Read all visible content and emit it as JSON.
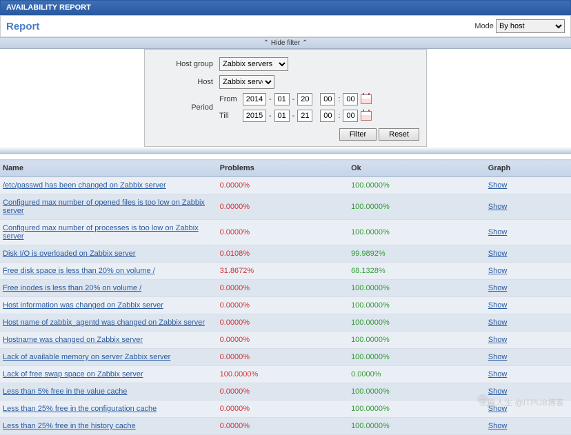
{
  "breadcrumb": "AVAILABILITY REPORT",
  "report_bar": {
    "title": "Report",
    "mode_label": "Mode",
    "mode_selected": "By host"
  },
  "filter_toggle": "Hide filter",
  "filter": {
    "host_group_label": "Host group",
    "host_group_value": "Zabbix servers",
    "host_label": "Host",
    "host_value": "Zabbix server",
    "period_label": "Period",
    "from_label": "From",
    "till_label": "Till",
    "from": {
      "y": "2014",
      "m": "01",
      "d": "20",
      "h": "00",
      "mi": "00"
    },
    "till": {
      "y": "2015",
      "m": "01",
      "d": "21",
      "h": "00",
      "mi": "00"
    },
    "filter_btn": "Filter",
    "reset_btn": "Reset"
  },
  "columns": {
    "name": "Name",
    "problems": "Problems",
    "ok": "Ok",
    "graph": "Graph"
  },
  "show_text": "Show",
  "rows": [
    {
      "name": "/etc/passwd has been changed on Zabbix server",
      "prob": "0.0000%",
      "ok": "100.0000%"
    },
    {
      "name": "Configured max number of opened files is too low on Zabbix server",
      "prob": "0.0000%",
      "ok": "100.0000%"
    },
    {
      "name": "Configured max number of processes is too low on Zabbix server",
      "prob": "0.0000%",
      "ok": "100.0000%"
    },
    {
      "name": "Disk I/O is overloaded on Zabbix server",
      "prob": "0.0108%",
      "ok": "99.9892%"
    },
    {
      "name": "Free disk space is less than 20% on volume /",
      "prob": "31.8672%",
      "ok": "68.1328%"
    },
    {
      "name": "Free inodes is less than 20% on volume /",
      "prob": "0.0000%",
      "ok": "100.0000%"
    },
    {
      "name": "Host information was changed on Zabbix server",
      "prob": "0.0000%",
      "ok": "100.0000%"
    },
    {
      "name": "Host name of zabbix_agentd was changed on Zabbix server",
      "prob": "0.0000%",
      "ok": "100.0000%"
    },
    {
      "name": "Hostname was changed on Zabbix server",
      "prob": "0.0000%",
      "ok": "100.0000%"
    },
    {
      "name": "Lack of available memory on server Zabbix server",
      "prob": "0.0000%",
      "ok": "100.0000%"
    },
    {
      "name": "Lack of free swap space on Zabbix server",
      "prob": "100.0000%",
      "ok": "0.0000%"
    },
    {
      "name": "Less than 5% free in the value cache",
      "prob": "0.0000%",
      "ok": "100.0000%"
    },
    {
      "name": "Less than 25% free in the configuration cache",
      "prob": "0.0000%",
      "ok": "100.0000%"
    },
    {
      "name": "Less than 25% free in the history cache",
      "prob": "0.0000%",
      "ok": "100.0000%"
    }
  ],
  "watermark": {
    "text1": "工匠人生",
    "text2": "@ITPUB博客"
  }
}
